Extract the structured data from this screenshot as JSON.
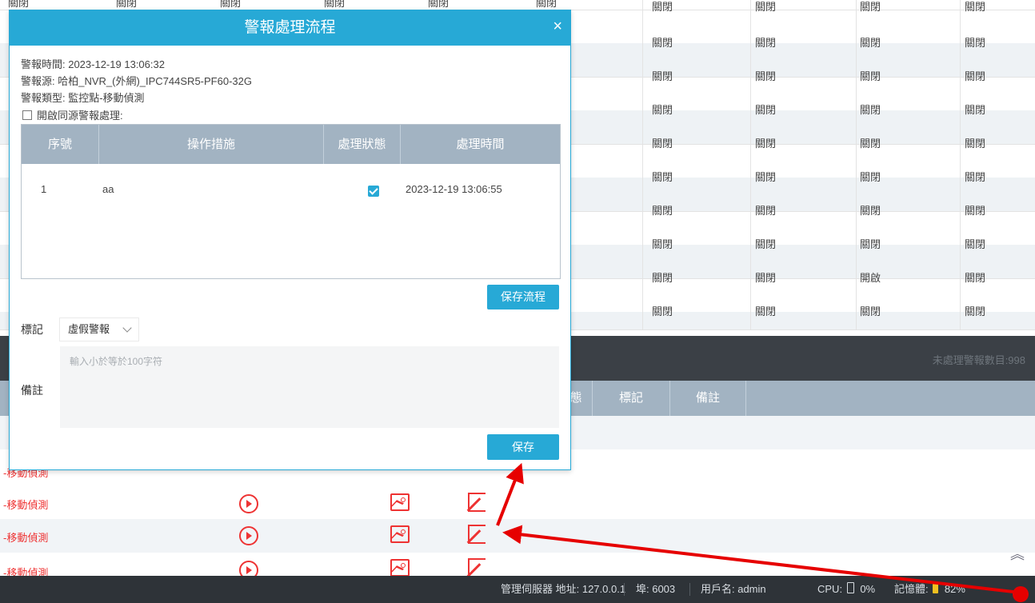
{
  "grid": {
    "top_partial": [
      "關閉",
      "關閉",
      "關閉",
      "關閉",
      "關閉",
      "關閉",
      "關閉",
      "關閉",
      "關閉",
      "關閉"
    ],
    "rows": [
      [
        "關閉",
        "關閉",
        "關閉",
        "關閉"
      ],
      [
        "關閉",
        "關閉",
        "關閉",
        "關閉"
      ],
      [
        "關閉",
        "關閉",
        "關閉",
        "關閉"
      ],
      [
        "關閉",
        "關閉",
        "關閉",
        "關閉"
      ],
      [
        "關閉",
        "關閉",
        "關閉",
        "關閉"
      ],
      [
        "關閉",
        "關閉",
        "關閉",
        "關閉"
      ],
      [
        "關閉",
        "關閉",
        "關閉",
        "關閉"
      ],
      [
        "關閉",
        "關閉",
        "開啟",
        "關閉"
      ],
      [
        "關閉",
        "關閉",
        "關閉",
        "關閉"
      ]
    ]
  },
  "alarm_panel": {
    "pending_count": "未處理警報數目:998",
    "headers": [
      "態",
      "標記",
      "備註"
    ],
    "rows": [
      "-移動偵測",
      "-移動偵測",
      "-移動偵測",
      "-移動偵測"
    ]
  },
  "dialog": {
    "title": "警報處理流程",
    "close": "×",
    "alarm_time": "警報時間: 2023-12-19 13:06:32",
    "alarm_source": "警報源: 哈柏_NVR_(外網)_IPC744SR5-PF60-32G",
    "alarm_type": "警報類型: 監控點-移動偵測",
    "same_source_label": "開啟同源警報處理:",
    "table": {
      "headers": [
        "序號",
        "操作措施",
        "處理狀態",
        "處理時間"
      ],
      "rows": [
        {
          "no": "1",
          "action": "aa",
          "done": true,
          "time": "2023-12-19 13:06:55"
        }
      ]
    },
    "save_flow": "保存流程",
    "mark_label": "標記",
    "mark_value": "虛假警報",
    "note_label": "備註",
    "note_placeholder": "輸入小於等於100字符",
    "save": "保存"
  },
  "status_bar": {
    "server": "管理伺服器 地址: 127.0.0.1",
    "port": "埠: 6003",
    "user": "用戶名: admin",
    "cpu": "0%",
    "cpu_label": "CPU:",
    "mem_label": "記憶體:",
    "mem": "82%"
  },
  "colors": {
    "accent": "#27a9d6",
    "header": "#a2b3c2",
    "alarm_text": "#ee3333",
    "dark_bar": "#3b4046",
    "status_bar": "#2e3338",
    "annotation": "#e60000"
  }
}
